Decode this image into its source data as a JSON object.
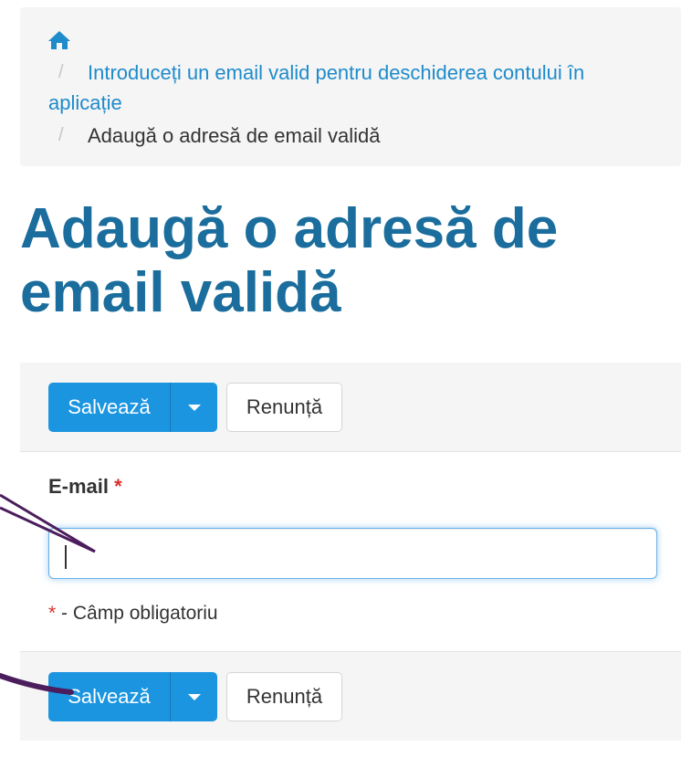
{
  "breadcrumb": {
    "home_icon": "home-icon",
    "separator": "/",
    "link_label": "Introduceți un email valid pentru deschiderea contului în aplicație",
    "current_label": "Adaugă o adresă de email validă"
  },
  "page": {
    "title": "Adaugă o adresă de email validă"
  },
  "toolbar": {
    "save_label": "Salvează",
    "cancel_label": "Renunță",
    "caret_icon": "caret-down-icon"
  },
  "form": {
    "email_label": "E-mail",
    "required_marker": "*",
    "email_value": "",
    "required_note": "- Câmp obligatoriu"
  },
  "colors": {
    "primary_button": "#1b95e0",
    "title": "#1a6d9c",
    "link": "#1e8bcb",
    "required": "#d9302c",
    "annotation": "#4b1d5c"
  }
}
